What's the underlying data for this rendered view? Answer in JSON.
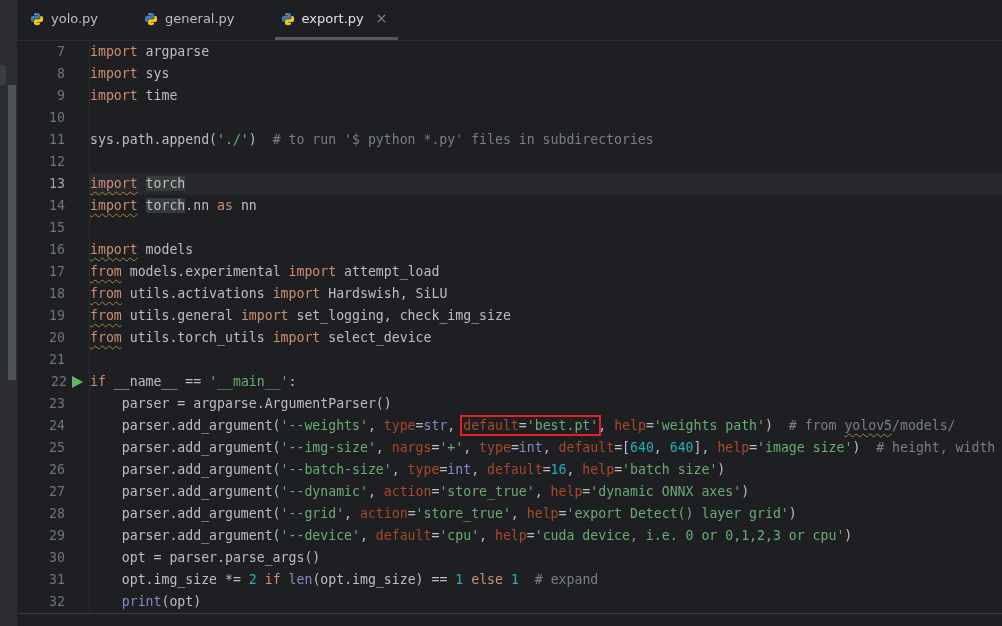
{
  "tabs": [
    {
      "label": "yolo.py",
      "selected": false
    },
    {
      "label": "general.py",
      "selected": false
    },
    {
      "label": "export.py",
      "selected": true
    }
  ],
  "editor": {
    "lines": [
      {
        "number": "7",
        "tokens": [
          {
            "text": "import",
            "kind": "kw"
          },
          {
            "text": " argparse",
            "kind": "pl"
          }
        ]
      },
      {
        "number": "8",
        "tokens": [
          {
            "text": "import",
            "kind": "kw"
          },
          {
            "text": " sys",
            "kind": "pl"
          }
        ]
      },
      {
        "number": "9",
        "tokens": [
          {
            "text": "import",
            "kind": "kw"
          },
          {
            "text": " time",
            "kind": "pl"
          }
        ]
      },
      {
        "number": "10"
      },
      {
        "number": "11",
        "tokens": [
          {
            "text": "sys.path.append(",
            "kind": "pl"
          },
          {
            "text": "'./'",
            "kind": "str"
          },
          {
            "text": ")  ",
            "kind": "pl"
          },
          {
            "text": "# to run '$ python *.py' files in subdirectories",
            "kind": "cm"
          }
        ]
      },
      {
        "number": "12"
      },
      {
        "number": "13",
        "current": true,
        "tokens": [
          {
            "text": "import",
            "kind": "kw",
            "underline": true
          },
          {
            "text": " torch",
            "kind": "pl",
            "usage": true
          }
        ]
      },
      {
        "number": "14",
        "tokens": [
          {
            "text": "import",
            "kind": "kw",
            "underline": true
          },
          {
            "text": " torch",
            "kind": "pl",
            "usage": true
          },
          {
            "text": ".nn ",
            "kind": "pl"
          },
          {
            "text": "as",
            "kind": "kw"
          },
          {
            "text": " nn",
            "kind": "pl"
          }
        ]
      },
      {
        "number": "15"
      },
      {
        "number": "16",
        "tokens": [
          {
            "text": "import",
            "kind": "kw",
            "underline": true
          },
          {
            "text": " models",
            "kind": "pl"
          }
        ]
      },
      {
        "number": "17",
        "tokens": [
          {
            "text": "from",
            "kind": "kw",
            "underline": true
          },
          {
            "text": " models.experimental ",
            "kind": "pl"
          },
          {
            "text": "import",
            "kind": "kw"
          },
          {
            "text": " attempt_load",
            "kind": "pl"
          }
        ]
      },
      {
        "number": "18",
        "tokens": [
          {
            "text": "from",
            "kind": "kw",
            "underline": true
          },
          {
            "text": " utils.activations ",
            "kind": "pl"
          },
          {
            "text": "import",
            "kind": "kw"
          },
          {
            "text": " Hardswish, SiLU",
            "kind": "pl"
          }
        ]
      },
      {
        "number": "19",
        "tokens": [
          {
            "text": "from",
            "kind": "kw",
            "underline": true
          },
          {
            "text": " utils.general ",
            "kind": "pl"
          },
          {
            "text": "import",
            "kind": "kw"
          },
          {
            "text": " set_logging, check_img_size",
            "kind": "pl"
          }
        ]
      },
      {
        "number": "20",
        "tokens": [
          {
            "text": "from",
            "kind": "kw",
            "underline": true
          },
          {
            "text": " utils.torch_utils ",
            "kind": "pl"
          },
          {
            "text": "import",
            "kind": "kw"
          },
          {
            "text": " select_device",
            "kind": "pl"
          }
        ]
      },
      {
        "number": "21"
      },
      {
        "number": "22",
        "runnable": true,
        "tokens": [
          {
            "text": "if",
            "kind": "kw"
          },
          {
            "text": " __name__ == ",
            "kind": "pl"
          },
          {
            "text": "'__main__'",
            "kind": "str"
          },
          {
            "text": ":",
            "kind": "pl"
          }
        ]
      },
      {
        "number": "23",
        "tokens": [
          {
            "text": "    parser = argparse.ArgumentParser()",
            "kind": "pl"
          }
        ]
      },
      {
        "number": "24",
        "tokens": [
          {
            "text": "    parser.add_argument(",
            "kind": "pl"
          },
          {
            "text": "'--weights'",
            "kind": "str"
          },
          {
            "text": ", ",
            "kind": "pl"
          },
          {
            "text": "type",
            "kind": "param"
          },
          {
            "text": "=",
            "kind": "pl"
          },
          {
            "text": "str",
            "kind": "bi"
          },
          {
            "text": ", ",
            "kind": "pl"
          },
          {
            "text": "default",
            "kind": "param",
            "boxed": true
          },
          {
            "text": "=",
            "kind": "pl",
            "boxed": true
          },
          {
            "text": "'best.pt'",
            "kind": "str",
            "boxed": true
          },
          {
            "text": ", ",
            "kind": "pl"
          },
          {
            "text": "help",
            "kind": "param"
          },
          {
            "text": "=",
            "kind": "pl"
          },
          {
            "text": "'weights path'",
            "kind": "str"
          },
          {
            "text": ")  ",
            "kind": "pl"
          },
          {
            "text": "# from ",
            "kind": "cm"
          },
          {
            "text": "yolov5",
            "kind": "cm",
            "underline": true
          },
          {
            "text": "/models/",
            "kind": "cm"
          }
        ]
      },
      {
        "number": "25",
        "tokens": [
          {
            "text": "    parser.add_argument(",
            "kind": "pl"
          },
          {
            "text": "'--img-size'",
            "kind": "str"
          },
          {
            "text": ", ",
            "kind": "pl"
          },
          {
            "text": "nargs",
            "kind": "param"
          },
          {
            "text": "=",
            "kind": "pl"
          },
          {
            "text": "'+'",
            "kind": "str"
          },
          {
            "text": ", ",
            "kind": "pl"
          },
          {
            "text": "type",
            "kind": "param"
          },
          {
            "text": "=",
            "kind": "pl"
          },
          {
            "text": "int",
            "kind": "bi"
          },
          {
            "text": ", ",
            "kind": "pl"
          },
          {
            "text": "default",
            "kind": "param"
          },
          {
            "text": "=[",
            "kind": "pl"
          },
          {
            "text": "640",
            "kind": "num"
          },
          {
            "text": ", ",
            "kind": "pl"
          },
          {
            "text": "640",
            "kind": "num"
          },
          {
            "text": "], ",
            "kind": "pl"
          },
          {
            "text": "help",
            "kind": "param"
          },
          {
            "text": "=",
            "kind": "pl"
          },
          {
            "text": "'image size'",
            "kind": "str"
          },
          {
            "text": ")  ",
            "kind": "pl"
          },
          {
            "text": "# height, width",
            "kind": "cm"
          }
        ]
      },
      {
        "number": "26",
        "tokens": [
          {
            "text": "    parser.add_argument(",
            "kind": "pl"
          },
          {
            "text": "'--batch-size'",
            "kind": "str"
          },
          {
            "text": ", ",
            "kind": "pl"
          },
          {
            "text": "type",
            "kind": "param"
          },
          {
            "text": "=",
            "kind": "pl"
          },
          {
            "text": "int",
            "kind": "bi"
          },
          {
            "text": ", ",
            "kind": "pl"
          },
          {
            "text": "default",
            "kind": "param"
          },
          {
            "text": "=",
            "kind": "pl"
          },
          {
            "text": "16",
            "kind": "num"
          },
          {
            "text": ", ",
            "kind": "pl"
          },
          {
            "text": "help",
            "kind": "param"
          },
          {
            "text": "=",
            "kind": "pl"
          },
          {
            "text": "'batch size'",
            "kind": "str"
          },
          {
            "text": ")",
            "kind": "pl"
          }
        ]
      },
      {
        "number": "27",
        "tokens": [
          {
            "text": "    parser.add_argument(",
            "kind": "pl"
          },
          {
            "text": "'--dynamic'",
            "kind": "str"
          },
          {
            "text": ", ",
            "kind": "pl"
          },
          {
            "text": "action",
            "kind": "param"
          },
          {
            "text": "=",
            "kind": "pl"
          },
          {
            "text": "'store_true'",
            "kind": "str"
          },
          {
            "text": ", ",
            "kind": "pl"
          },
          {
            "text": "help",
            "kind": "param"
          },
          {
            "text": "=",
            "kind": "pl"
          },
          {
            "text": "'dynamic ONNX axes'",
            "kind": "str"
          },
          {
            "text": ")",
            "kind": "pl"
          }
        ]
      },
      {
        "number": "28",
        "tokens": [
          {
            "text": "    parser.add_argument(",
            "kind": "pl"
          },
          {
            "text": "'--grid'",
            "kind": "str"
          },
          {
            "text": ", ",
            "kind": "pl"
          },
          {
            "text": "action",
            "kind": "param"
          },
          {
            "text": "=",
            "kind": "pl"
          },
          {
            "text": "'store_true'",
            "kind": "str"
          },
          {
            "text": ", ",
            "kind": "pl"
          },
          {
            "text": "help",
            "kind": "param"
          },
          {
            "text": "=",
            "kind": "pl"
          },
          {
            "text": "'export Detect() layer grid'",
            "kind": "str"
          },
          {
            "text": ")",
            "kind": "pl"
          }
        ]
      },
      {
        "number": "29",
        "tokens": [
          {
            "text": "    parser.add_argument(",
            "kind": "pl"
          },
          {
            "text": "'--device'",
            "kind": "str"
          },
          {
            "text": ", ",
            "kind": "pl"
          },
          {
            "text": "default",
            "kind": "param"
          },
          {
            "text": "=",
            "kind": "pl"
          },
          {
            "text": "'cpu'",
            "kind": "str"
          },
          {
            "text": ", ",
            "kind": "pl"
          },
          {
            "text": "help",
            "kind": "param"
          },
          {
            "text": "=",
            "kind": "pl"
          },
          {
            "text": "'cuda device, i.e. 0 or 0,1,2,3 or cpu'",
            "kind": "str"
          },
          {
            "text": ")",
            "kind": "pl"
          }
        ]
      },
      {
        "number": "30",
        "tokens": [
          {
            "text": "    opt = parser.parse_args()",
            "kind": "pl"
          }
        ]
      },
      {
        "number": "31",
        "tokens": [
          {
            "text": "    opt.img_size *= ",
            "kind": "pl"
          },
          {
            "text": "2",
            "kind": "num"
          },
          {
            "text": " if",
            "kind": "kw"
          },
          {
            "text": " len",
            "kind": "bi"
          },
          {
            "text": "(opt.img_size) == ",
            "kind": "pl"
          },
          {
            "text": "1",
            "kind": "num"
          },
          {
            "text": " else",
            "kind": "kw"
          },
          {
            "text": " 1",
            "kind": "num"
          },
          {
            "text": "  # expand",
            "kind": "cm"
          }
        ]
      },
      {
        "number": "32",
        "tokens": [
          {
            "text": "    print",
            "kind": "bi"
          },
          {
            "text": "(opt)",
            "kind": "pl"
          }
        ]
      }
    ]
  }
}
